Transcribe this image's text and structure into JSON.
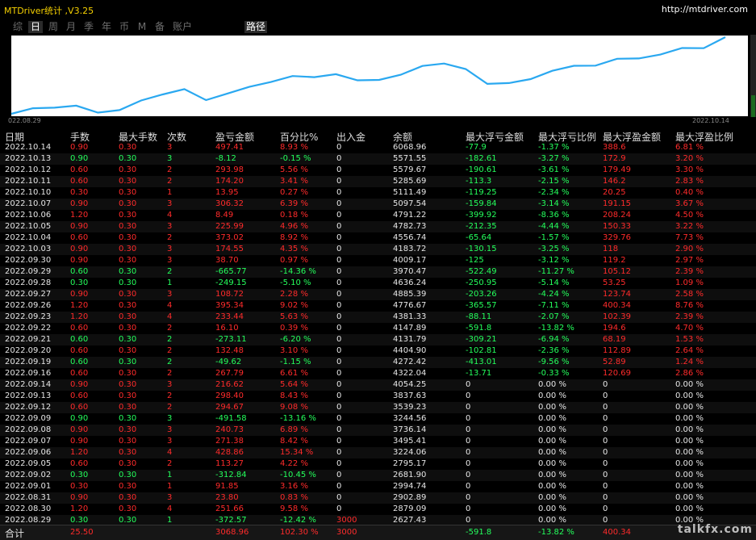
{
  "app": {
    "title": "MTDriver统计 ,V3.25",
    "site": "http://mtdriver.com"
  },
  "tabs": [
    {
      "label": "综",
      "active": false
    },
    {
      "label": "日",
      "active": true
    },
    {
      "label": "周",
      "active": false
    },
    {
      "label": "月",
      "active": false
    },
    {
      "label": "季",
      "active": false
    },
    {
      "label": "年",
      "active": false
    },
    {
      "label": "币",
      "active": false
    },
    {
      "label": "M",
      "active": false
    },
    {
      "label": "备",
      "active": false
    },
    {
      "label": "账户",
      "active": false
    }
  ],
  "path_tab": "路径",
  "chart_data": {
    "type": "line",
    "x_start_label": "022.08.29",
    "x_end_label": "2022.10.14",
    "line_color": "#2aa8f0",
    "series": [
      {
        "values": [
          2627.43,
          2879.09,
          2902.89,
          2994.74,
          2681.9,
          2795.17,
          3224.06,
          3495.41,
          3736.14,
          3244.56,
          3539.23,
          3837.63,
          4054.25,
          4322.04,
          4272.42,
          4404.9,
          4131.79,
          4147.89,
          4381.33,
          4776.67,
          4885.39,
          4636.24,
          3970.47,
          4009.17,
          4183.72,
          4556.74,
          4782.73,
          4791.22,
          5097.54,
          5111.49,
          5285.69,
          5579.67,
          5571.55,
          6068.96
        ],
        "ylim": [
          2627.43,
          6068.96
        ]
      }
    ]
  },
  "table": {
    "headers": [
      "日期",
      "手数",
      "最大手数",
      "次数",
      "盈亏金额",
      "百分比%",
      "出入金",
      "余额",
      "最大浮亏金额",
      "最大浮亏比例",
      "最大浮盈金额",
      "最大浮盈比例"
    ],
    "rows": [
      [
        "2022.10.14",
        "0.90",
        "0.30",
        "3",
        "497.41",
        "8.93 %",
        "0",
        "6068.96",
        "-77.9",
        "-1.37 %",
        "388.6",
        "6.81 %"
      ],
      [
        "2022.10.13",
        "0.90",
        "0.30",
        "3",
        "-8.12",
        "-0.15 %",
        "0",
        "5571.55",
        "-182.61",
        "-3.27 %",
        "172.9",
        "3.20 %"
      ],
      [
        "2022.10.12",
        "0.60",
        "0.30",
        "2",
        "293.98",
        "5.56 %",
        "0",
        "5579.67",
        "-190.61",
        "-3.61 %",
        "179.49",
        "3.30 %"
      ],
      [
        "2022.10.11",
        "0.60",
        "0.30",
        "2",
        "174.20",
        "3.41 %",
        "0",
        "5285.69",
        "-113.3",
        "-2.15 %",
        "146.2",
        "2.83 %"
      ],
      [
        "2022.10.10",
        "0.30",
        "0.30",
        "1",
        "13.95",
        "0.27 %",
        "0",
        "5111.49",
        "-119.25",
        "-2.34 %",
        "20.25",
        "0.40 %"
      ],
      [
        "2022.10.07",
        "0.90",
        "0.30",
        "3",
        "306.32",
        "6.39 %",
        "0",
        "5097.54",
        "-159.84",
        "-3.14 %",
        "191.15",
        "3.67 %"
      ],
      [
        "2022.10.06",
        "1.20",
        "0.30",
        "4",
        "8.49",
        "0.18 %",
        "0",
        "4791.22",
        "-399.92",
        "-8.36 %",
        "208.24",
        "4.50 %"
      ],
      [
        "2022.10.05",
        "0.90",
        "0.30",
        "3",
        "225.99",
        "4.96 %",
        "0",
        "4782.73",
        "-212.35",
        "-4.44 %",
        "150.33",
        "3.22 %"
      ],
      [
        "2022.10.04",
        "0.60",
        "0.30",
        "2",
        "373.02",
        "8.92 %",
        "0",
        "4556.74",
        "-65.64",
        "-1.57 %",
        "329.76",
        "7.73 %"
      ],
      [
        "2022.10.03",
        "0.90",
        "0.30",
        "3",
        "174.55",
        "4.35 %",
        "0",
        "4183.72",
        "-130.15",
        "-3.25 %",
        "118",
        "2.90 %"
      ],
      [
        "2022.09.30",
        "0.90",
        "0.30",
        "3",
        "38.70",
        "0.97 %",
        "0",
        "4009.17",
        "-125",
        "-3.12 %",
        "119.2",
        "2.97 %"
      ],
      [
        "2022.09.29",
        "0.60",
        "0.30",
        "2",
        "-665.77",
        "-14.36 %",
        "0",
        "3970.47",
        "-522.49",
        "-11.27 %",
        "105.12",
        "2.39 %"
      ],
      [
        "2022.09.28",
        "0.30",
        "0.30",
        "1",
        "-249.15",
        "-5.10 %",
        "0",
        "4636.24",
        "-250.95",
        "-5.14 %",
        "53.25",
        "1.09 %"
      ],
      [
        "2022.09.27",
        "0.90",
        "0.30",
        "3",
        "108.72",
        "2.28 %",
        "0",
        "4885.39",
        "-203.26",
        "-4.24 %",
        "123.74",
        "2.58 %"
      ],
      [
        "2022.09.26",
        "1.20",
        "0.30",
        "4",
        "395.34",
        "9.02 %",
        "0",
        "4776.67",
        "-365.57",
        "-7.11 %",
        "400.34",
        "8.76 %"
      ],
      [
        "2022.09.23",
        "1.20",
        "0.30",
        "4",
        "233.44",
        "5.63 %",
        "0",
        "4381.33",
        "-88.11",
        "-2.07 %",
        "102.39",
        "2.39 %"
      ],
      [
        "2022.09.22",
        "0.60",
        "0.30",
        "2",
        "16.10",
        "0.39 %",
        "0",
        "4147.89",
        "-591.8",
        "-13.82 %",
        "194.6",
        "4.70 %"
      ],
      [
        "2022.09.21",
        "0.60",
        "0.30",
        "2",
        "-273.11",
        "-6.20 %",
        "0",
        "4131.79",
        "-309.21",
        "-6.94 %",
        "68.19",
        "1.53 %"
      ],
      [
        "2022.09.20",
        "0.60",
        "0.30",
        "2",
        "132.48",
        "3.10 %",
        "0",
        "4404.90",
        "-102.81",
        "-2.36 %",
        "112.89",
        "2.64 %"
      ],
      [
        "2022.09.19",
        "0.60",
        "0.30",
        "2",
        "-49.62",
        "-1.15 %",
        "0",
        "4272.42",
        "-413.01",
        "-9.56 %",
        "52.89",
        "1.24 %"
      ],
      [
        "2022.09.16",
        "0.60",
        "0.30",
        "2",
        "267.79",
        "6.61 %",
        "0",
        "4322.04",
        "-13.71",
        "-0.33 %",
        "120.69",
        "2.86 %"
      ],
      [
        "2022.09.14",
        "0.90",
        "0.30",
        "3",
        "216.62",
        "5.64 %",
        "0",
        "4054.25",
        "0",
        "0.00 %",
        "0",
        "0.00 %"
      ],
      [
        "2022.09.13",
        "0.60",
        "0.30",
        "2",
        "298.40",
        "8.43 %",
        "0",
        "3837.63",
        "0",
        "0.00 %",
        "0",
        "0.00 %"
      ],
      [
        "2022.09.12",
        "0.60",
        "0.30",
        "2",
        "294.67",
        "9.08 %",
        "0",
        "3539.23",
        "0",
        "0.00 %",
        "0",
        "0.00 %"
      ],
      [
        "2022.09.09",
        "0.90",
        "0.30",
        "3",
        "-491.58",
        "-13.16 %",
        "0",
        "3244.56",
        "0",
        "0.00 %",
        "0",
        "0.00 %"
      ],
      [
        "2022.09.08",
        "0.90",
        "0.30",
        "3",
        "240.73",
        "6.89 %",
        "0",
        "3736.14",
        "0",
        "0.00 %",
        "0",
        "0.00 %"
      ],
      [
        "2022.09.07",
        "0.90",
        "0.30",
        "3",
        "271.38",
        "8.42 %",
        "0",
        "3495.41",
        "0",
        "0.00 %",
        "0",
        "0.00 %"
      ],
      [
        "2022.09.06",
        "1.20",
        "0.30",
        "4",
        "428.86",
        "15.34 %",
        "0",
        "3224.06",
        "0",
        "0.00 %",
        "0",
        "0.00 %"
      ],
      [
        "2022.09.05",
        "0.60",
        "0.30",
        "2",
        "113.27",
        "4.22 %",
        "0",
        "2795.17",
        "0",
        "0.00 %",
        "0",
        "0.00 %"
      ],
      [
        "2022.09.02",
        "0.30",
        "0.30",
        "1",
        "-312.84",
        "-10.45 %",
        "0",
        "2681.90",
        "0",
        "0.00 %",
        "0",
        "0.00 %"
      ],
      [
        "2022.09.01",
        "0.30",
        "0.30",
        "1",
        "91.85",
        "3.16 %",
        "0",
        "2994.74",
        "0",
        "0.00 %",
        "0",
        "0.00 %"
      ],
      [
        "2022.08.31",
        "0.90",
        "0.30",
        "3",
        "23.80",
        "0.83 %",
        "0",
        "2902.89",
        "0",
        "0.00 %",
        "0",
        "0.00 %"
      ],
      [
        "2022.08.30",
        "1.20",
        "0.30",
        "4",
        "251.66",
        "9.58 %",
        "0",
        "2879.09",
        "0",
        "0.00 %",
        "0",
        "0.00 %"
      ],
      [
        "2022.08.29",
        "0.30",
        "0.30",
        "1",
        "-372.57",
        "-12.42 %",
        "3000",
        "2627.43",
        "0",
        "0.00 %",
        "0",
        "0.00 %"
      ]
    ],
    "total": [
      "合计",
      "25.50",
      "",
      "",
      "3068.96",
      "102.30 %",
      "3000",
      "",
      "-591.8",
      "-13.82 %",
      "400.34",
      ""
    ]
  },
  "colors": {
    "profit": "#ff2b2b",
    "loss": "#24ff5c",
    "neutral": "#e6e6e6",
    "title": "#f5d000"
  },
  "watermark": "talkfx.com"
}
